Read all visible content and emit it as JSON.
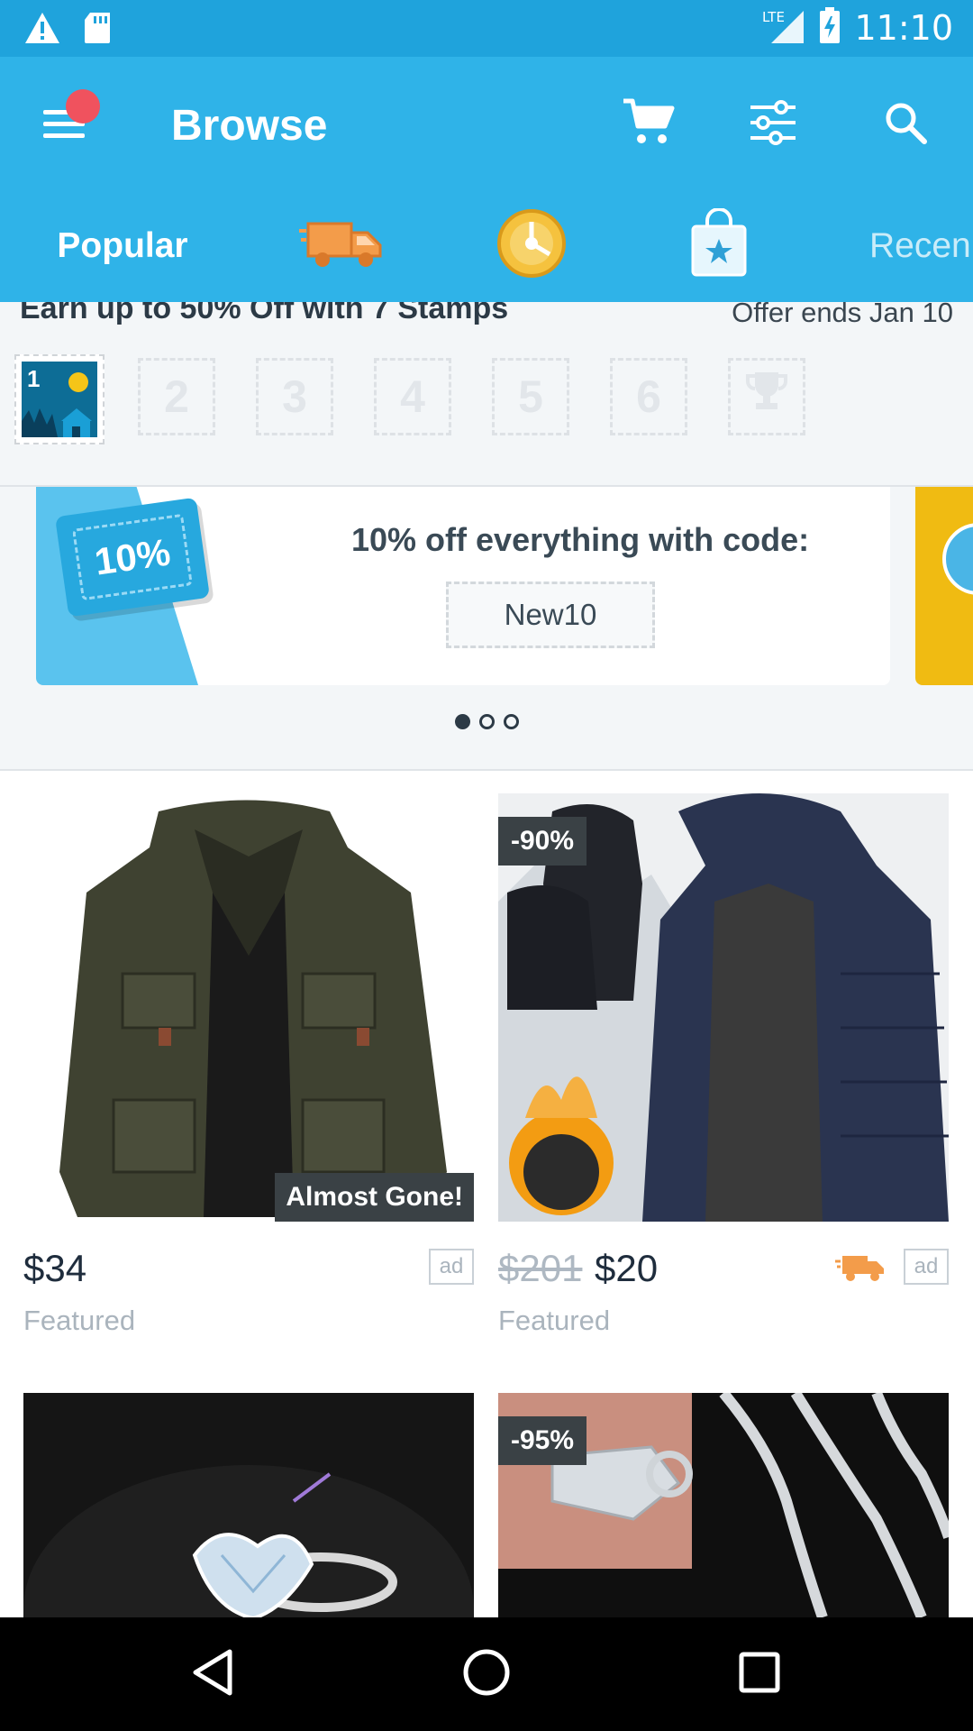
{
  "status_bar": {
    "network": "LTE",
    "time": "11:10"
  },
  "appbar": {
    "title": "Browse"
  },
  "tabs": [
    {
      "label": "Popular",
      "type": "text"
    },
    {
      "label": "",
      "type": "icon",
      "icon": "truck-icon"
    },
    {
      "label": "",
      "type": "icon",
      "icon": "wheel-icon"
    },
    {
      "label": "",
      "type": "icon",
      "icon": "shopping-bag-icon"
    },
    {
      "label": "Recen",
      "type": "text"
    }
  ],
  "stamps": {
    "title": "Earn up to 50% Off with 7 Stamps",
    "offer_ends": "Offer ends Jan 10",
    "first_stamp": "1",
    "boxes": [
      "2",
      "3",
      "4",
      "5",
      "6"
    ]
  },
  "promo": {
    "ticket_text": "10%",
    "headline": "10% off everything with code:",
    "code": "New10",
    "page_count": 3,
    "active_page": 1
  },
  "products": [
    {
      "price": "$34",
      "subtitle": "Featured",
      "badge": "Almost Gone!",
      "ad": "ad"
    },
    {
      "old_price": "$201",
      "price": "$20",
      "subtitle": "Featured",
      "discount": "-90%",
      "ad": "ad"
    },
    {
      "discount": ""
    },
    {
      "discount": "-95%"
    }
  ],
  "colors": {
    "primary": "#2fb3e8",
    "status_bar": "#1fa3dc",
    "notification_dot": "#f0525e",
    "discount_badge": "#3a4145",
    "truck_orange": "#f39c4a"
  }
}
